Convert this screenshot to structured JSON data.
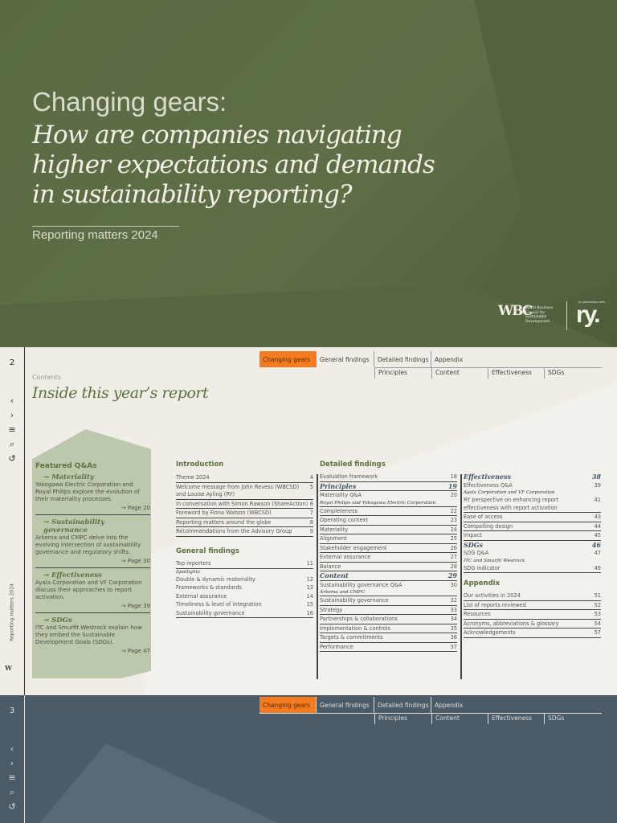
{
  "cover": {
    "title_line1": "Changing gears:",
    "title_line2": "How are companies navigating",
    "title_line3": "higher expectations and demands",
    "title_line4": "in sustainability reporting?",
    "subtitle": "Reporting matters 2024",
    "logo_wbcsd_mark": "WBC",
    "logo_wbcsd_text": "World Business Council for Sustainable Development",
    "logo_partner_text": "In partnership with",
    "logo_ry": "ry."
  },
  "nav": {
    "tabs": [
      "Changing gears",
      "General findings",
      "Detailed findings",
      "Appendix"
    ],
    "subtabs": [
      "Principles",
      "Content",
      "Effectiveness",
      "SDGs"
    ]
  },
  "page2": {
    "number": "2",
    "side_label": "Reporting matters 2024",
    "eyebrow": "Contents",
    "title": "Inside this year’s report",
    "featured": {
      "heading": "Featured Q&As",
      "items": [
        {
          "title": "→ Materiality",
          "desc": "Yokogawa Electric Corporation and Royal Philips explore the evolution of their materiality processes.",
          "page": "→ Page 20"
        },
        {
          "title": "→ Sustainability governance",
          "desc": "Arkema and CMPC delve into the evolving intersection of sustainability governance and regulatory shifts.",
          "page": "→ Page 30"
        },
        {
          "title": "→ Effectiveness",
          "desc": "Ayala Corporation and VF Corporation discuss their approaches to report activation.",
          "page": "→ Page 39"
        },
        {
          "title": "→ SDGs",
          "desc": "ITC and Smurfit Westrock explain how they embed the Sustainable Development Goals (SDGs).",
          "page": "→ Page 47"
        }
      ]
    },
    "introduction": {
      "heading": "Introduction",
      "rows": [
        {
          "label": "Theme 2024",
          "page": "4"
        },
        {
          "label": "Welcome message from John Revess (WBCSD) and Louise Ayling (RY)",
          "page": "5"
        },
        {
          "label": "In conversation with Simon Rawson (ShareAction)",
          "page": "6"
        },
        {
          "label": "Foreword by Fiona Watson (WBCSD)",
          "page": "7"
        },
        {
          "label": "Reporting matters around the globe",
          "page": "8"
        },
        {
          "label": "Recommendations from the Advisory Group",
          "page": "9"
        }
      ]
    },
    "general": {
      "heading": "General findings",
      "rows": [
        {
          "label": "Top reporters",
          "page": "11"
        },
        {
          "note": "Spotlights"
        },
        {
          "label": "Double & dynamic materiality",
          "page": "12",
          "plain": true
        },
        {
          "label": "Frameworks & standards",
          "page": "13",
          "plain": true
        },
        {
          "label": "External assurance",
          "page": "14",
          "plain": true
        },
        {
          "label": "Timeliness & level of integration",
          "page": "15",
          "plain": true
        },
        {
          "label": "Sustainability governance",
          "page": "16"
        }
      ]
    },
    "detailed": {
      "heading": "Detailed findings",
      "rows": [
        {
          "label": "Evaluation framework",
          "page": "18"
        },
        {
          "label": "Principles",
          "page": "19",
          "sec": true
        },
        {
          "label": "Materiality Q&A",
          "page": "20",
          "plain": true
        },
        {
          "note": "Royal Philips and Yokogawa Electric Corporation",
          "last": true
        },
        {
          "label": "Completeness",
          "page": "22"
        },
        {
          "label": "Operating context",
          "page": "23"
        },
        {
          "label": "Materiality",
          "page": "24"
        },
        {
          "label": "Alignment",
          "page": "25"
        },
        {
          "label": "Stakeholder engagement",
          "page": "26"
        },
        {
          "label": "External assurance",
          "page": "27"
        },
        {
          "label": "Balance",
          "page": "28"
        },
        {
          "label": "Content",
          "page": "29",
          "sec": true
        },
        {
          "label": "Sustainability governance Q&A",
          "page": "30",
          "plain": true
        },
        {
          "note": "Arkema and CMPC",
          "last": true
        },
        {
          "label": "Sustainability governance",
          "page": "32"
        },
        {
          "label": "Strategy",
          "page": "33"
        },
        {
          "label": "Partnerships & collaborations",
          "page": "34"
        },
        {
          "label": "Implementation & controls",
          "page": "35"
        },
        {
          "label": "Targets & commitments",
          "page": "36"
        },
        {
          "label": "Performance",
          "page": "37"
        }
      ]
    },
    "right": {
      "rows": [
        {
          "label": "Effectiveness",
          "page": "38",
          "sec": true,
          "plain": true
        },
        {
          "label": "Effectiveness Q&A",
          "page": "39",
          "plain": true
        },
        {
          "note": "Ayala Corporation and VF Corporation"
        },
        {
          "label": "RY perspective on enhancing report effectiveness with report activation",
          "page": "41"
        },
        {
          "label": "Ease of access",
          "page": "43"
        },
        {
          "label": "Compelling design",
          "page": "44"
        },
        {
          "label": "Impact",
          "page": "45"
        },
        {
          "label": "SDGs",
          "page": "46",
          "sec": true,
          "plain": true
        },
        {
          "label": "SDG Q&A",
          "page": "47",
          "plain": true
        },
        {
          "note": "ITC and Smurfit Westrock"
        },
        {
          "label": "SDG indicator",
          "page": "49"
        }
      ]
    },
    "appendix": {
      "heading": "Appendix",
      "rows": [
        {
          "label": "Our activities in 2024",
          "page": "51"
        },
        {
          "label": "List of reports reviewed",
          "page": "52"
        },
        {
          "label": "Resources",
          "page": "53"
        },
        {
          "label": "Acronyms, abbreviations & glossary",
          "page": "54"
        },
        {
          "label": "Acknowledgements",
          "page": "57"
        }
      ]
    }
  },
  "page3": {
    "number": "3"
  },
  "colors": {
    "cover": "#5c6b45",
    "accent": "#f47b20",
    "page2": "#efede6",
    "page3": "#4b5c68",
    "green_text": "#5d7040"
  }
}
